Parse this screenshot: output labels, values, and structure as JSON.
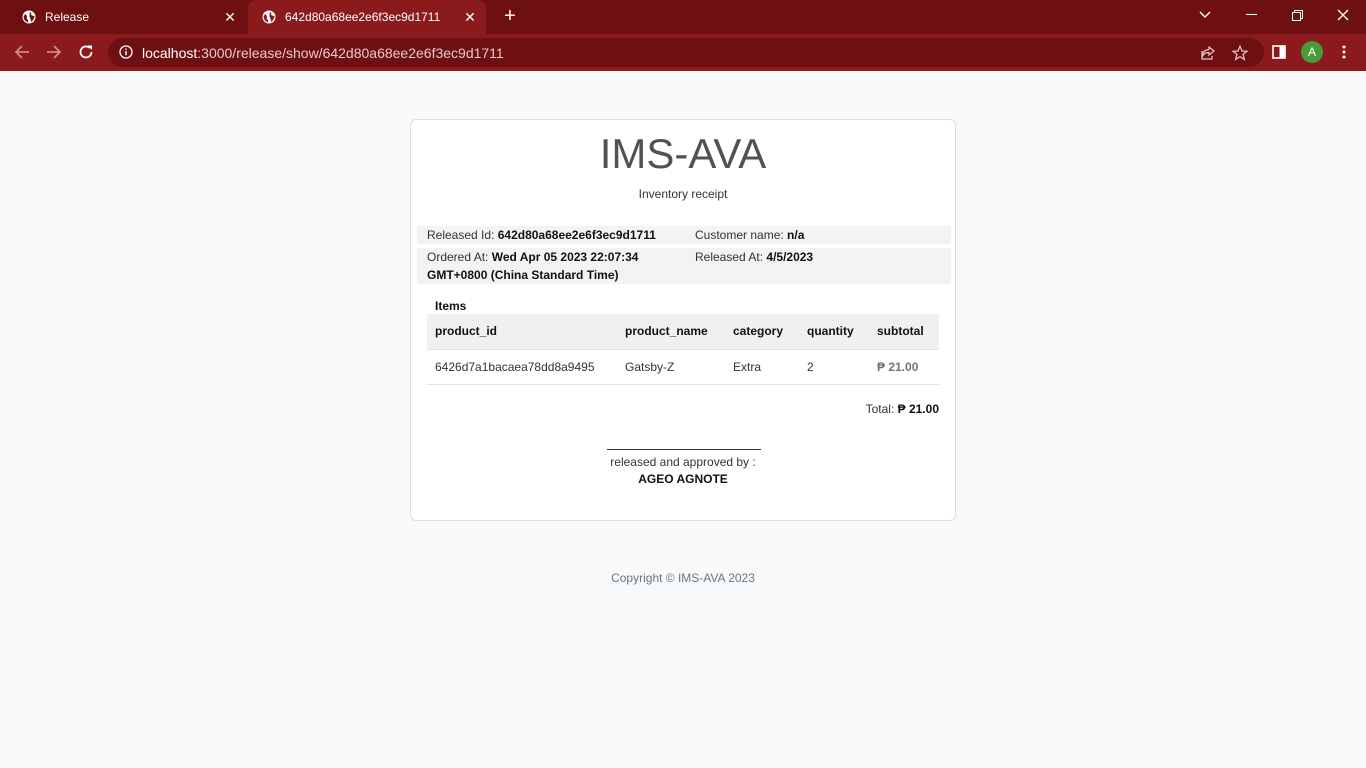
{
  "browser": {
    "tabs": [
      {
        "title": "Release",
        "active": false
      },
      {
        "title": "642d80a68ee2e6f3ec9d1711",
        "active": true
      }
    ],
    "address": {
      "host": "localhost",
      "path": ":3000/release/show/642d80a68ee2e6f3ec9d1711"
    },
    "profile_initial": "A",
    "colors": {
      "frame": "#6e0f12",
      "toolbar": "#8b1a1d",
      "profile": "#4b9b3c"
    }
  },
  "receipt": {
    "title": "IMS-AVA",
    "subtitle": "Inventory receipt",
    "released_id_label": "Released Id:",
    "released_id": "642d80a68ee2e6f3ec9d1711",
    "customer_label": "Customer name:",
    "customer_name": "n/a",
    "ordered_label": "Ordered At:",
    "ordered_at_line1": "Wed Apr 05 2023 22:07:34",
    "ordered_at_line2": "GMT+0800 (China Standard Time)",
    "released_label": "Released At:",
    "released_at": "4/5/2023",
    "items_label": "Items",
    "columns": [
      "product_id",
      "product_name",
      "category",
      "quantity",
      "subtotal"
    ],
    "rows": [
      {
        "product_id": "6426d7a1bacaea78dd8a9495",
        "product_name": "Gatsby-Z",
        "category": "Extra",
        "quantity": "2",
        "subtotal": "₱ 21.00"
      }
    ],
    "total_label": "Total:",
    "total": "₱ 21.00",
    "signature_caption": "released and approved by :",
    "signature_name": "AGEO AGNOTE"
  },
  "footer": {
    "copyright": "Copyright © IMS-AVA 2023"
  }
}
